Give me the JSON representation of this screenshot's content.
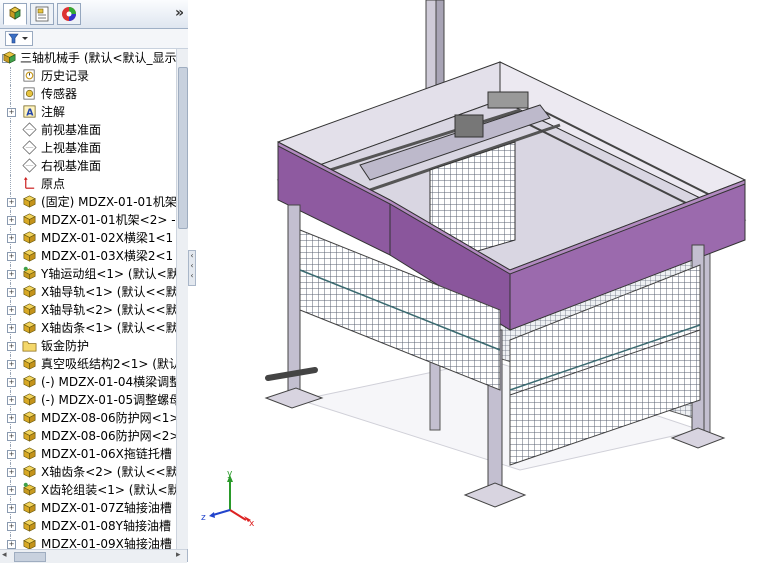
{
  "panel": {
    "tabs": [
      {
        "icon": "feature-manager-icon",
        "active": true
      },
      {
        "icon": "property-manager-icon",
        "active": false
      },
      {
        "icon": "appearance-icon",
        "active": false
      }
    ],
    "more_label": "»"
  },
  "tree": [
    {
      "label": "三轴机械手  (默认<默认_显示",
      "icon": "assembly-icon",
      "expander": "-",
      "level": 0
    },
    {
      "label": "历史记录",
      "icon": "history-icon",
      "expander": "",
      "level": 1
    },
    {
      "label": "传感器",
      "icon": "sensor-icon",
      "expander": "",
      "level": 1
    },
    {
      "label": "注解",
      "icon": "annotation-icon",
      "expander": "+",
      "level": 1
    },
    {
      "label": "前视基准面",
      "icon": "plane-icon",
      "expander": "",
      "level": 1
    },
    {
      "label": "上视基准面",
      "icon": "plane-icon",
      "expander": "",
      "level": 1
    },
    {
      "label": "右视基准面",
      "icon": "plane-icon",
      "expander": "",
      "level": 1
    },
    {
      "label": "原点",
      "icon": "origin-icon",
      "expander": "",
      "level": 1
    },
    {
      "label": "(固定) MDZX-01-01机架",
      "icon": "part-icon",
      "expander": "+",
      "level": 1
    },
    {
      "label": "MDZX-01-01机架<2> -",
      "icon": "part-icon",
      "expander": "+",
      "level": 1
    },
    {
      "label": "MDZX-01-02X横梁1<1",
      "icon": "part-icon",
      "expander": "+",
      "level": 1
    },
    {
      "label": "MDZX-01-03X横梁2<1",
      "icon": "part-icon",
      "expander": "+",
      "level": 1
    },
    {
      "label": "Y轴运动组<1> (默认<默",
      "icon": "subassembly-icon",
      "expander": "+",
      "level": 1
    },
    {
      "label": "X轴导轨<1> (默认<<默",
      "icon": "part-icon",
      "expander": "+",
      "level": 1
    },
    {
      "label": "X轴导轨<2> (默认<<默",
      "icon": "part-icon",
      "expander": "+",
      "level": 1
    },
    {
      "label": "X轴齿条<1> (默认<<默",
      "icon": "part-icon",
      "expander": "+",
      "level": 1
    },
    {
      "label": "钣金防护",
      "icon": "folder-icon",
      "expander": "+",
      "level": 1
    },
    {
      "label": "真空吸纸结构2<1> (默认",
      "icon": "part-icon",
      "expander": "+",
      "level": 1
    },
    {
      "label": "(-) MDZX-01-04横梁调整",
      "icon": "part-icon",
      "expander": "+",
      "level": 1
    },
    {
      "label": "(-) MDZX-01-05调整螺母",
      "icon": "part-icon",
      "expander": "+",
      "level": 1
    },
    {
      "label": "MDZX-08-06防护网<1>",
      "icon": "part-icon",
      "expander": "+",
      "level": 1
    },
    {
      "label": "MDZX-08-06防护网<2>",
      "icon": "part-icon",
      "expander": "+",
      "level": 1
    },
    {
      "label": "MDZX-01-06X拖链托槽",
      "icon": "part-icon",
      "expander": "+",
      "level": 1
    },
    {
      "label": "X轴齿条<2> (默认<<默",
      "icon": "part-icon",
      "expander": "+",
      "level": 1
    },
    {
      "label": "X齿轮组装<1> (默认<默",
      "icon": "subassembly-icon",
      "expander": "+",
      "level": 1
    },
    {
      "label": "MDZX-01-07Z轴接油槽",
      "icon": "part-icon",
      "expander": "+",
      "level": 1
    },
    {
      "label": "MDZX-01-08Y轴接油槽",
      "icon": "part-icon",
      "expander": "+",
      "level": 1
    },
    {
      "label": "MDZX-01-09X轴接油槽",
      "icon": "part-icon",
      "expander": "+",
      "level": 1
    }
  ],
  "triad": {
    "x": "x",
    "y": "y",
    "z": "z"
  },
  "colors": {
    "frame": "#b9b4c6",
    "guard": "#8e5aa0",
    "mesh": "#5a6070",
    "part_icon": "#e8c440"
  }
}
